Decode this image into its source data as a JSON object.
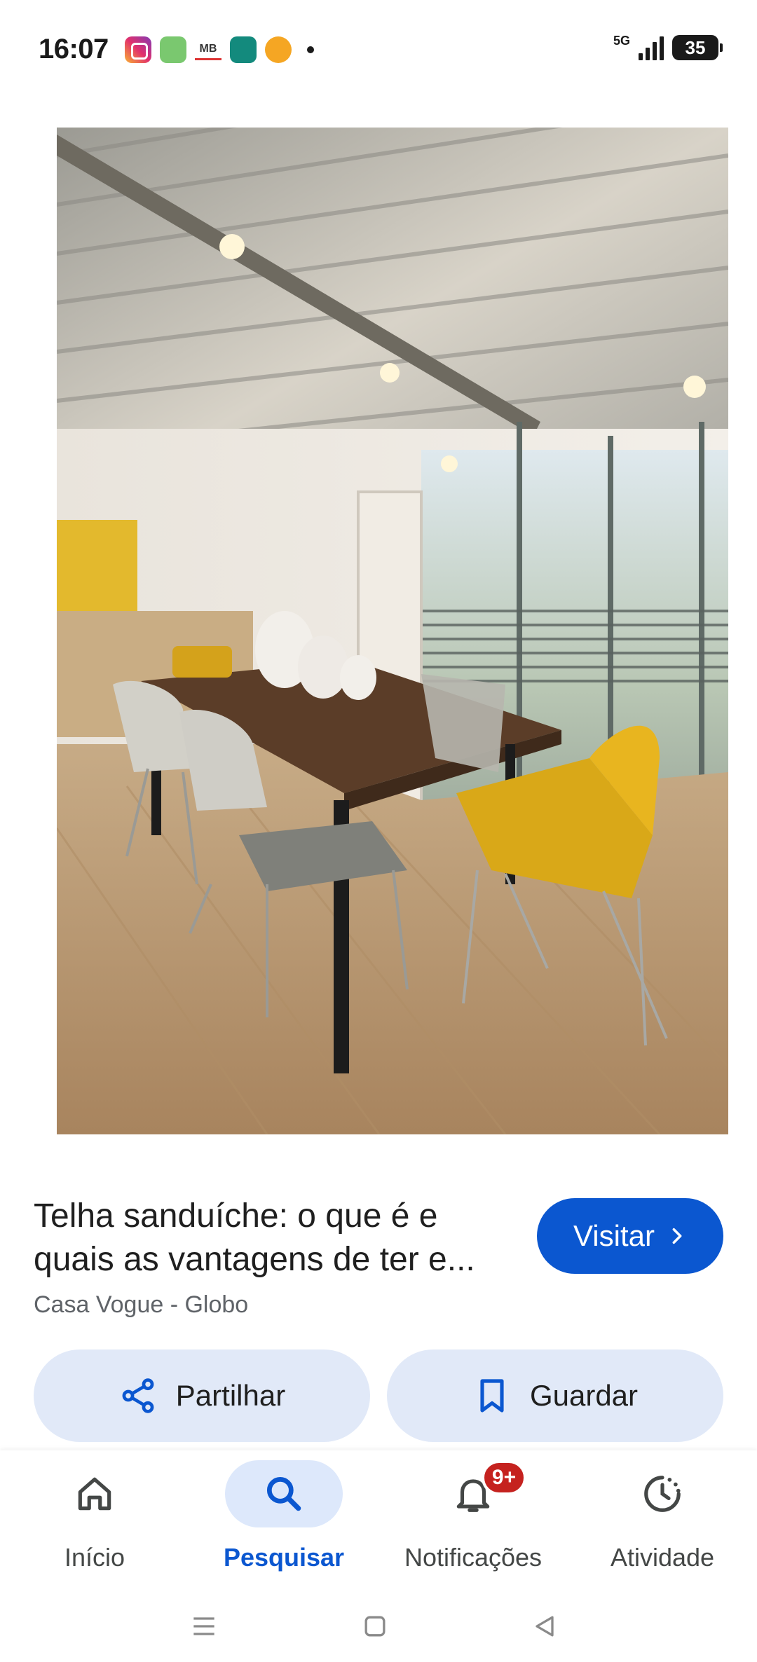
{
  "status_bar": {
    "time": "16:07",
    "network": "5G",
    "battery": "35",
    "notification_icons": [
      "instagram-icon",
      "biblia-estudo-icon",
      "mb-icon",
      "teal-app-icon",
      "orange-app-icon"
    ]
  },
  "result": {
    "image_alt": "dining-room-photo",
    "title": "Telha sanduíche: o que é e quais as vantagens de ter e...",
    "source": "Casa Vogue - Globo",
    "visit_label": "Visitar",
    "share_label": "Partilhar",
    "save_label": "Guardar"
  },
  "bottom_nav": {
    "items": [
      {
        "label": "Início",
        "icon": "home-icon"
      },
      {
        "label": "Pesquisar",
        "icon": "search-icon",
        "active": true
      },
      {
        "label": "Notificações",
        "icon": "bell-icon",
        "badge": "9+"
      },
      {
        "label": "Atividade",
        "icon": "activity-icon"
      }
    ]
  },
  "colors": {
    "accent": "#0b57d0",
    "button_tonal": "#e1e9f8",
    "badge": "#c5221f",
    "nav_active_pill": "#dde8fb"
  }
}
